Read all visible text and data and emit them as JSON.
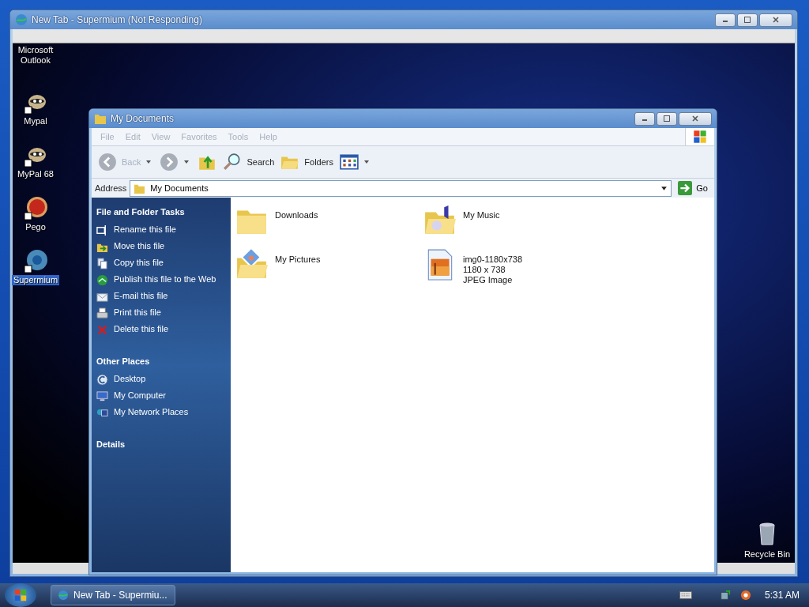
{
  "outer_window": {
    "title": "New Tab - Supermium (Not Responding)"
  },
  "desktop_icons": [
    {
      "label": "Microsoft Outlook",
      "kind": "hidden",
      "selected": false
    },
    {
      "label": "Mypal",
      "kind": "raccoon",
      "selected": false
    },
    {
      "label": "MyPal 68",
      "kind": "raccoon",
      "selected": false
    },
    {
      "label": "Pego",
      "kind": "orb",
      "selected": false
    },
    {
      "label": "Supermium",
      "kind": "globe",
      "selected": true
    }
  ],
  "recycle_bin": {
    "label": "Recycle Bin"
  },
  "explorer": {
    "title": "My Documents",
    "menu": [
      "File",
      "Edit",
      "View",
      "Favorites",
      "Tools",
      "Help"
    ],
    "toolbar": {
      "back": "Back",
      "search": "Search",
      "folders": "Folders"
    },
    "address": {
      "label": "Address",
      "value": "My Documents",
      "go": "Go"
    },
    "task_sections": [
      {
        "title": "File and Folder Tasks",
        "items": [
          {
            "label": "Rename this file",
            "kind": "rename"
          },
          {
            "label": "Move this file",
            "kind": "move"
          },
          {
            "label": "Copy this file",
            "kind": "copy"
          },
          {
            "label": "Publish this file to the Web",
            "kind": "publish"
          },
          {
            "label": "E-mail this file",
            "kind": "email"
          },
          {
            "label": "Print this file",
            "kind": "print"
          },
          {
            "label": "Delete this file",
            "kind": "delete"
          }
        ]
      },
      {
        "title": "Other Places",
        "items": [
          {
            "label": "Desktop",
            "kind": "desktop"
          },
          {
            "label": "My Computer",
            "kind": "computer"
          },
          {
            "label": "My Network Places",
            "kind": "network"
          }
        ]
      },
      {
        "title": "Details"
      }
    ],
    "files": [
      {
        "name": "Downloads",
        "kind": "folder"
      },
      {
        "name": "My Music",
        "kind": "music"
      },
      {
        "name": "My Pictures",
        "kind": "pictures"
      },
      {
        "name": "img0-1180x738",
        "kind": "image",
        "details": [
          "1180 x 738",
          "JPEG Image"
        ]
      }
    ]
  },
  "taskbar": {
    "tasks": [
      {
        "label": "New Tab - Supermiu...",
        "selected": false
      }
    ],
    "clock": "5:31 AM"
  }
}
